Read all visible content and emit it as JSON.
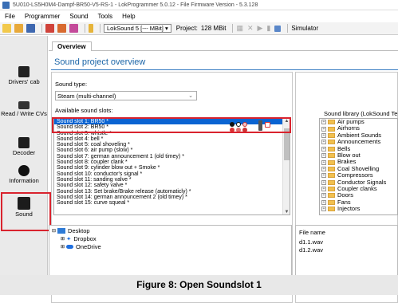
{
  "window": {
    "title": "5U010-LS5H0M4-Dampf-BR50-V5-RS-1 - LokProgrammer 5.0.12 - File Firmware Version - 5.3.128"
  },
  "menu": [
    "File",
    "Programmer",
    "Sound",
    "Tools",
    "Help"
  ],
  "toolbar": {
    "decoder": "LokSound 5 [--- MBit]",
    "project": "Project:",
    "project_size": "128 MBit",
    "simulator": "Simulator"
  },
  "sidebar": [
    {
      "label": "Drivers' cab"
    },
    {
      "label": "Read / Write CVs"
    },
    {
      "label": "Decoder"
    },
    {
      "label": "Information"
    },
    {
      "label": "Sound"
    }
  ],
  "tab": "Overview",
  "heading": "Sound project overview",
  "sound_type": {
    "label": "Sound type:",
    "value": "Steam (multi-channel)"
  },
  "slots_label": "Available sound slots:",
  "slots": [
    "Sound slot 1: BR50 *",
    "Sound slot 2: BR50 *",
    "Sound slot 3: whistle *",
    "Sound slot 4: bell *",
    "Sound slot 5: coal shoveling *",
    "Sound slot 6: air pump (slow) *",
    "Sound slot 7: german announcement 1 (old timey) *",
    "Sound slot 8: coupler clank *",
    "Sound slot 9: cylinder blow out + Smoke *",
    "Sound slot 10: conductor's signal *",
    "Sound slot 11: sanding valve *",
    "Sound slot 12: safety valve *",
    "Sound slot 13: Set brake/Brake release (automaticly) *",
    "Sound slot 14: german announcement 2 (old timey) *",
    "Sound slot 15: curve squeal *"
  ],
  "library": {
    "label": "Sound library (LokSound Te",
    "items": [
      "Air pumps",
      "Airhorns",
      "Ambient Sounds",
      "Announcements",
      "Bells",
      "Blow out",
      "Brakes",
      "Coal Shovelling",
      "Compressors",
      "Conductor Signals",
      "Coupler clanks",
      "Doors",
      "Fans",
      "Injectors"
    ]
  },
  "filetree": [
    "Desktop",
    "Dropbox",
    "OneDrive"
  ],
  "files": {
    "header": "File name",
    "items": [
      "d1.1.wav",
      "d1.2.wav"
    ]
  },
  "caption": "Figure 8: Open Soundslot 1",
  "colors": {
    "accent": "#1b65a7",
    "highlight": "#d9232e",
    "selection": "#0a64d2"
  }
}
